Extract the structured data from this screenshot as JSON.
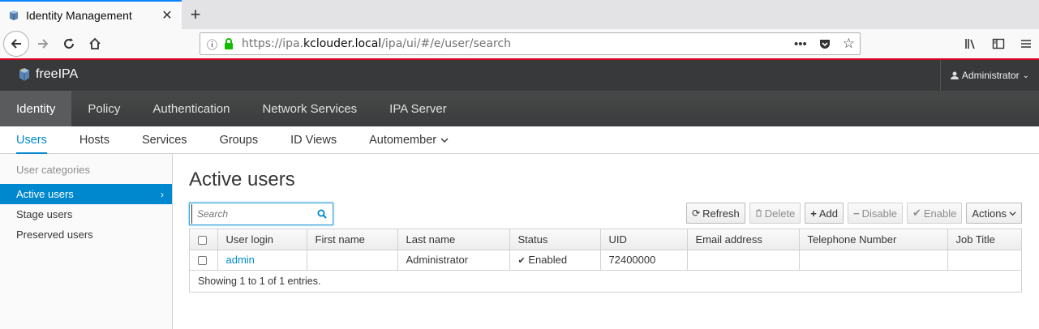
{
  "browser": {
    "tab_title": "Identity Management",
    "url_prefix": "https://ipa.",
    "url_domain": "kclouder.local",
    "url_path": "/ipa/ui/#/e/user/search"
  },
  "masthead": {
    "logo_text": "freeIPA",
    "user_label": "Administrator"
  },
  "primary_nav": [
    "Identity",
    "Policy",
    "Authentication",
    "Network Services",
    "IPA Server"
  ],
  "secondary_nav": [
    "Users",
    "Hosts",
    "Services",
    "Groups",
    "ID Views",
    "Automember"
  ],
  "sidebar": {
    "heading": "User categories",
    "items": [
      "Active users",
      "Stage users",
      "Preserved users"
    ]
  },
  "main": {
    "title": "Active users",
    "search_placeholder": "Search",
    "buttons": {
      "refresh": "Refresh",
      "delete": "Delete",
      "add": "Add",
      "disable": "Disable",
      "enable": "Enable",
      "actions": "Actions"
    }
  },
  "table": {
    "columns": [
      "User login",
      "First name",
      "Last name",
      "Status",
      "UID",
      "Email address",
      "Telephone Number",
      "Job Title"
    ],
    "rows": [
      {
        "login": "admin",
        "first_name": "",
        "last_name": "Administrator",
        "status": "Enabled",
        "uid": "72400000",
        "email": "",
        "phone": "",
        "job_title": ""
      }
    ],
    "footer": "Showing 1 to 1 of 1 entries."
  },
  "colors": {
    "accent": "#0088ce",
    "masthead": "#38393b",
    "url_underline": "#d70022"
  }
}
